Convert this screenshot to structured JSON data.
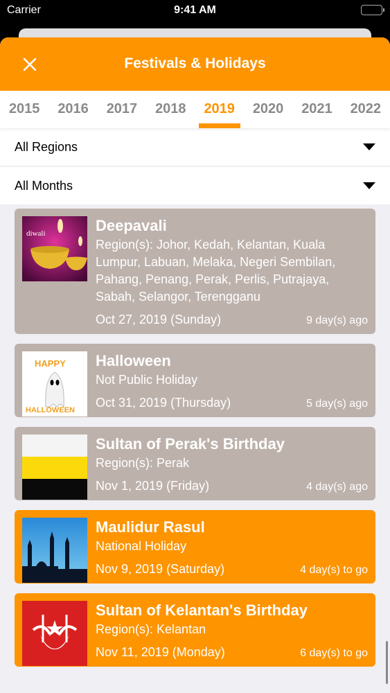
{
  "status_bar": {
    "carrier": "Carrier",
    "time": "9:41 AM"
  },
  "header": {
    "title": "Festivals & Holidays",
    "close_icon": "close-icon"
  },
  "colors": {
    "accent": "#fe9400",
    "past_card": "#bdb1ab",
    "upcoming_card": "#fe9400"
  },
  "years": {
    "selected": "2019",
    "items": [
      "2015",
      "2016",
      "2017",
      "2018",
      "2019",
      "2020",
      "2021",
      "2022"
    ]
  },
  "filters": {
    "region": {
      "value": "All Regions"
    },
    "month": {
      "value": "All Months"
    }
  },
  "holidays": [
    {
      "name": "Deepavali",
      "subtitle": "Region(s): Johor, Kedah, Kelantan, Kuala Lumpur, Labuan, Melaka, Negeri Sembilan, Pahang, Penang, Perak, Perlis, Putrajaya, Sabah, Selangor, Terengganu",
      "date": "Oct 27, 2019 (Sunday)",
      "relative": "9 day(s) ago",
      "status": "past",
      "image": "diwali-lamp-image"
    },
    {
      "name": "Halloween",
      "subtitle": "Not Public Holiday",
      "date": "Oct 31, 2019 (Thursday)",
      "relative": "5 day(s) ago",
      "status": "past",
      "image": "halloween-ghost-image"
    },
    {
      "name": "Sultan of Perak's Birthday",
      "subtitle": "Region(s): Perak",
      "date": "Nov 1, 2019 (Friday)",
      "relative": "4 day(s) ago",
      "status": "past",
      "image": "perak-flag-image"
    },
    {
      "name": "Maulidur Rasul",
      "subtitle": "National Holiday",
      "date": "Nov 9, 2019 (Saturday)",
      "relative": "4 day(s) to go",
      "status": "upcoming",
      "image": "mosque-silhouette-image"
    },
    {
      "name": "Sultan of Kelantan's Birthday",
      "subtitle": "Region(s): Kelantan",
      "date": "Nov 11, 2019 (Monday)",
      "relative": "6 day(s) to go",
      "status": "upcoming",
      "image": "kelantan-flag-image"
    }
  ]
}
